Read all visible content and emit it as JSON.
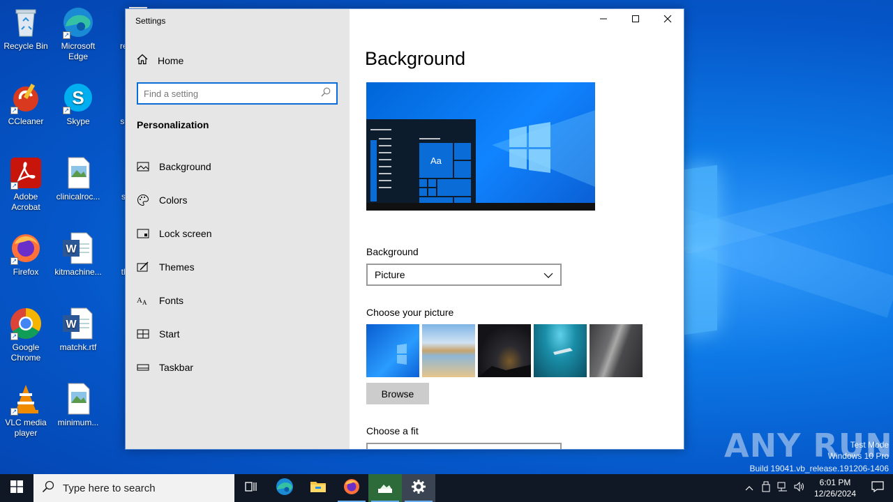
{
  "desktop": {
    "icons_col1": [
      {
        "label": "Recycle Bin",
        "icon": "recycle-bin-icon"
      },
      {
        "label": "CCleaner",
        "icon": "ccleaner-icon"
      },
      {
        "label": "Adobe Acrobat",
        "icon": "adobe-acrobat-icon"
      },
      {
        "label": "Firefox",
        "icon": "firefox-icon"
      },
      {
        "label": "Google Chrome",
        "icon": "chrome-icon"
      },
      {
        "label": "VLC media player",
        "icon": "vlc-icon"
      }
    ],
    "icons_col2": [
      {
        "label": "Microsoft Edge",
        "icon": "edge-icon"
      },
      {
        "label": "Skype",
        "icon": "skype-icon"
      },
      {
        "label": "clinicalroc...",
        "icon": "image-file-icon"
      },
      {
        "label": "kitmachine...",
        "icon": "word-doc-icon"
      },
      {
        "label": "matchk.rtf",
        "icon": "word-doc-icon"
      },
      {
        "label": "minimum...",
        "icon": "image-file-icon"
      }
    ],
    "icons_col3": [
      {
        "label": "respe",
        "icon": "word-doc-icon"
      },
      {
        "label": "secur",
        "icon": "word-doc-icon"
      },
      {
        "label": "supp",
        "icon": "word-doc-icon"
      },
      {
        "label": "thurs",
        "icon": "word-doc-icon"
      }
    ]
  },
  "window": {
    "title": "Settings",
    "controls": [
      "minimize-icon",
      "maximize-icon",
      "close-icon"
    ],
    "sidebar": {
      "home_label": "Home",
      "search_placeholder": "Find a setting",
      "section_title": "Personalization",
      "items": [
        {
          "label": "Background",
          "icon": "picture-icon"
        },
        {
          "label": "Colors",
          "icon": "palette-icon"
        },
        {
          "label": "Lock screen",
          "icon": "lock-screen-icon"
        },
        {
          "label": "Themes",
          "icon": "themes-icon"
        },
        {
          "label": "Fonts",
          "icon": "fonts-icon"
        },
        {
          "label": "Start",
          "icon": "start-icon"
        },
        {
          "label": "Taskbar",
          "icon": "taskbar-icon"
        }
      ]
    },
    "content": {
      "heading": "Background",
      "preview_sample_text": "Aa",
      "background_label": "Background",
      "background_value": "Picture",
      "choose_picture_label": "Choose your picture",
      "browse_label": "Browse",
      "choose_fit_label": "Choose a fit"
    }
  },
  "watermark": {
    "logo": "ANY RUN",
    "line1": "Test Mode",
    "line2": "Windows 10 Pro",
    "line3": "Build 19041.vb_release.191206-1406"
  },
  "taskbar": {
    "search_placeholder": "Type here to search",
    "apps": [
      "task-view-icon",
      "edge-icon",
      "file-explorer-icon",
      "firefox-icon",
      "installer-icon",
      "settings-gear-icon"
    ],
    "time": "6:01 PM",
    "date": "12/26/2024"
  }
}
